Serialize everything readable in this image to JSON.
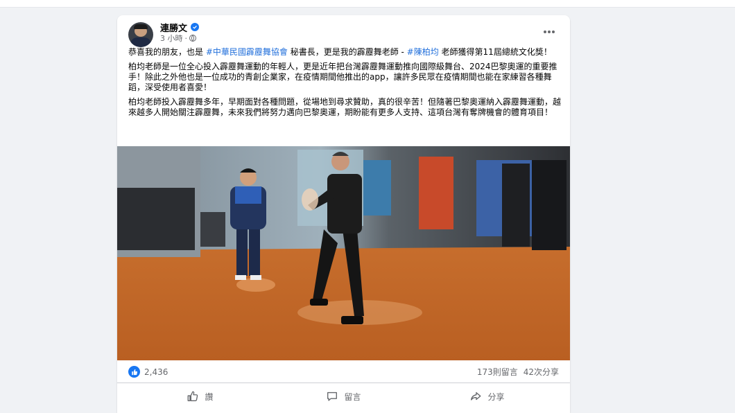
{
  "post": {
    "author": "連勝文",
    "time": "3 小時",
    "separator": "·",
    "paragraphs": [
      {
        "segments": [
          {
            "text": "恭喜我的朋友，也是 ",
            "link": false
          },
          {
            "text": "#中華民國霹靂舞協會",
            "link": true
          },
          {
            "text": " 秘書長，更是我的霹靂舞老師 - ",
            "link": false
          },
          {
            "text": "#陳柏均",
            "link": true
          },
          {
            "text": " 老師獲得第11屆總統文化獎！",
            "link": false
          }
        ]
      },
      {
        "segments": [
          {
            "text": "柏均老師是一位全心投入霹靂舞運動的年輕人，更是近年把台灣霹靂舞運動推向國際級舞台、2024巴黎奧運的重要推手！除此之外他也是一位成功的青創企業家，在疫情期間他推出的app，讓許多民眾在疫情期間也能在家練習各種舞蹈，深受使用者喜愛！",
            "link": false
          }
        ]
      },
      {
        "segments": [
          {
            "text": "柏均老師投入霹靂舞多年，早期面對各種問題，從場地到尋求贊助，真的很辛苦！但隨著巴黎奧運納入霹靂舞運動，越來越多人開始關注霹靂舞，未來我們將努力邁向巴黎奧運，期盼能有更多人支持、這項台灣有奪牌機會的體育項目！",
            "link": false
          }
        ]
      }
    ]
  },
  "reactions": {
    "likes": "2,436",
    "comments": "173則留言",
    "shares": "42次分享"
  },
  "actions": {
    "like": "讚",
    "comment": "留言",
    "share": "分享"
  },
  "colors": {
    "accent": "#1877f2",
    "hashtag": "#216fdb",
    "secondary_text": "#65676b",
    "floor": "#c86f2d"
  },
  "icons": [
    "verified-badge-icon",
    "globe-icon",
    "more-options-icon",
    "like-reaction-icon",
    "thumbs-up-icon",
    "comment-icon",
    "share-icon"
  ]
}
